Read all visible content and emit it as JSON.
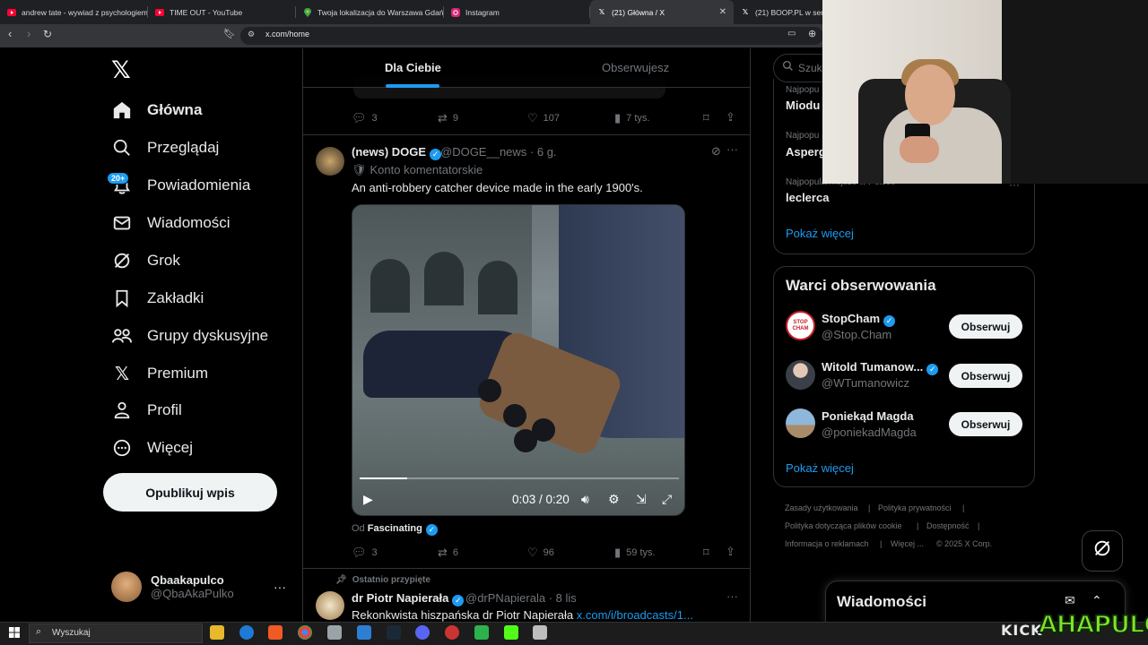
{
  "browser": {
    "tabs": [
      {
        "title": "andrew tate - wywiad z psychologiem",
        "favicon": "youtube-icon",
        "active": false
      },
      {
        "title": "TIME OUT - YouTube",
        "favicon": "youtube-icon",
        "active": false
      },
      {
        "title": "Twoja lokalizacja do Warszawa Gdań",
        "favicon": "maps-icon",
        "active": false
      },
      {
        "title": "Instagram",
        "favicon": "instagram-icon",
        "active": false
      },
      {
        "title": "(21) Główna / X",
        "favicon": "x-icon",
        "active": true
      },
      {
        "title": "(21) BOOP.PL w ser",
        "favicon": "x-icon",
        "active": false
      }
    ],
    "url": "x.com/home"
  },
  "nav": {
    "items": [
      {
        "label": "Główna",
        "icon": "home-icon"
      },
      {
        "label": "Przeglądaj",
        "icon": "search-icon"
      },
      {
        "label": "Powiadomienia",
        "icon": "bell-icon"
      },
      {
        "label": "Wiadomości",
        "icon": "envelope-icon"
      },
      {
        "label": "Grok",
        "icon": "grok-icon"
      },
      {
        "label": "Zakładki",
        "icon": "bookmark-icon"
      },
      {
        "label": "Grupy dyskusyjne",
        "icon": "communities-icon"
      },
      {
        "label": "Premium",
        "icon": "x-icon"
      },
      {
        "label": "Profil",
        "icon": "person-icon"
      },
      {
        "label": "Więcej",
        "icon": "more-circle-icon"
      }
    ],
    "notif_badge": "20+",
    "post_button": "Opublikuj wpis",
    "account": {
      "name": "Qbaakapulco",
      "handle": "@QbaAkaPulko"
    }
  },
  "feed": {
    "tabs": [
      "Dla Ciebie",
      "Obserwujesz"
    ],
    "prev_post_actions": {
      "replies": "3",
      "reposts": "9",
      "likes": "107",
      "views": "7 tys."
    },
    "post": {
      "name": "(news) DOGE",
      "handle": "@DOGE__news",
      "time": "6 g.",
      "label": "Konto komentatorskie",
      "text": "An anti-robbery catcher device made in the early 1900's.",
      "video_time": "0:03 / 0:20",
      "video_progress": 0.15,
      "from_label": "Od",
      "from_name": "Fascinating",
      "actions": {
        "replies": "3",
        "reposts": "6",
        "likes": "96",
        "views": "59 tys."
      }
    },
    "pinned_post": {
      "pinned_label": "Ostatnio przypięte",
      "name": "dr Piotr Napierała",
      "handle": "@drPNapierala",
      "time": "8 lis",
      "text": "Rekonkwista hiszpańska dr Piotr Napierała",
      "link": "x.com/i/broadcasts/1..."
    }
  },
  "sidebar": {
    "search_placeholder": "Szuk",
    "trends": [
      {
        "sub": "Najpopu",
        "title": "Miodu"
      },
      {
        "sub": "Najpopu",
        "title": "Asperg"
      },
      {
        "sub": "Najpopularniejsze w Polsce",
        "title": "leclerca"
      }
    ],
    "show_more": "Pokaż więcej",
    "who_to_follow": {
      "title": "Warci obserwowania",
      "users": [
        {
          "name": "StopCham",
          "handle": "@Stop.Cham",
          "avatar_text": "STOP CHAM"
        },
        {
          "name": "Witold Tumanow...",
          "handle": "@WTumanowicz",
          "avatar_text": ""
        },
        {
          "name": "Poniekąd Magda",
          "handle": "@poniekadMagda",
          "avatar_text": ""
        }
      ],
      "follow_label": "Obserwuj",
      "show_more": "Pokaż więcej"
    },
    "footer": {
      "links": [
        "Zasady użytkowania",
        "Polityka prywatności",
        "Polityka dotycząca plików cookie",
        "Dostępność",
        "Informacja o reklamach",
        "Więcej ...",
        "© 2025 X Corp."
      ]
    },
    "messages_title": "Wiadomości"
  },
  "overlay": {
    "kick": "KICK",
    "brand": "AHAPULCO"
  },
  "taskbar": {
    "search_placeholder": "Wyszukaj"
  }
}
